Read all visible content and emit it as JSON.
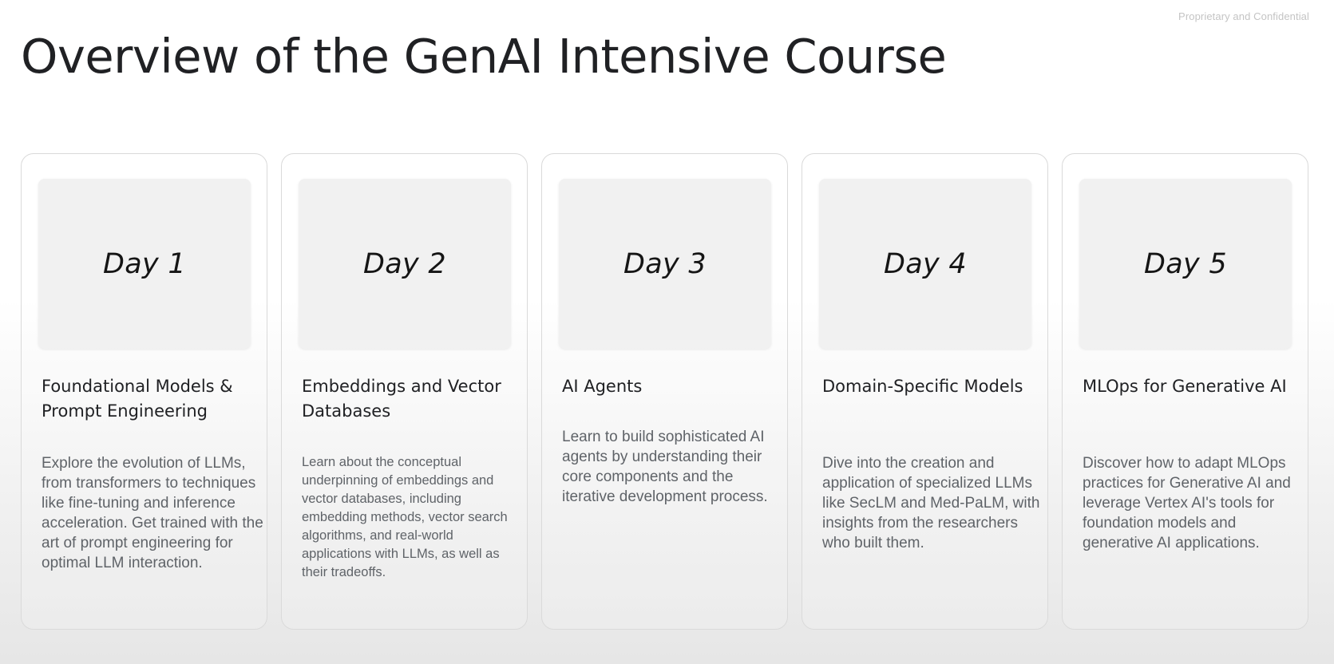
{
  "header": {
    "confidential": "Proprietary and Confidential",
    "title": "Overview of the GenAI Intensive Course"
  },
  "days": [
    {
      "day": "Day 1",
      "title": "Foundational Models & Prompt Engineering",
      "description": "Explore the evolution of LLMs, from transformers to techniques like fine-tuning and inference acceleration. Get trained with the art of prompt engineering for optimal LLM interaction."
    },
    {
      "day": "Day 2",
      "title": "Embeddings and Vector Databases",
      "description": "Learn about the conceptual underpinning of embeddings and vector databases, including embedding methods, vector search algorithms, and real-world applications with LLMs, as well as their tradeoffs."
    },
    {
      "day": "Day 3",
      "title": "AI Agents",
      "description": "Learn to build sophisticated AI agents by understanding their core components and the iterative development process."
    },
    {
      "day": "Day 4",
      "title": "Domain-Specific Models",
      "description": "Dive into the creation and application of specialized LLMs like SecLM and Med-PaLM, with insights from the researchers who built them."
    },
    {
      "day": "Day 5",
      "title": "MLOps for Generative AI",
      "description": "Discover how to adapt MLOps practices for Generative AI and leverage Vertex AI's tools for foundation models and generative AI applications."
    }
  ]
}
